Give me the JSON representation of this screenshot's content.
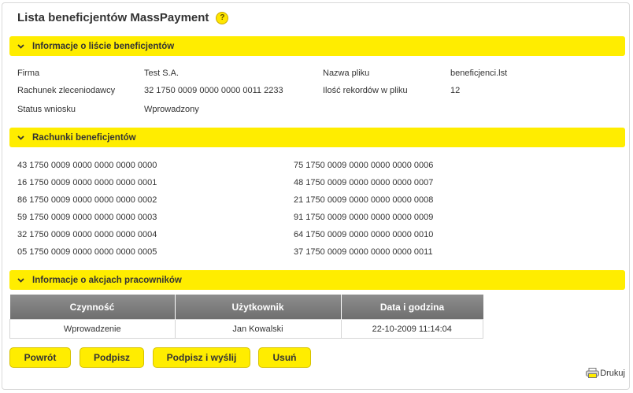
{
  "page": {
    "title": "Lista beneficjentów MassPayment",
    "help_icon": "?"
  },
  "sections": {
    "info": {
      "label": "Informacje o liście beneficjentów"
    },
    "accounts": {
      "label": "Rachunki beneficjentów"
    },
    "actions": {
      "label": "Informacje o akcjach pracowników"
    }
  },
  "info": {
    "firma_label": "Firma",
    "firma_value": "Test S.A.",
    "rachunek_label": "Rachunek zleceniodawcy",
    "rachunek_value": "32 1750 0009 0000 0000 0011 2233",
    "status_label": "Status wniosku",
    "status_value": "Wprowadzony",
    "plik_label": "Nazwa pliku",
    "plik_value": "beneficjenci.lst",
    "rekordy_label": "Ilość rekordów w pliku",
    "rekordy_value": "12"
  },
  "accounts_left": [
    "43 1750 0009 0000 0000 0000 0000",
    "16 1750 0009 0000 0000 0000 0001",
    "86 1750 0009 0000 0000 0000 0002",
    "59 1750 0009 0000 0000 0000 0003",
    "32 1750 0009 0000 0000 0000 0004",
    "05 1750 0009 0000 0000 0000 0005"
  ],
  "accounts_right": [
    "75 1750 0009 0000 0000 0000 0006",
    "48 1750 0009 0000 0000 0000 0007",
    "21 1750 0009 0000 0000 0000 0008",
    "91 1750 0009 0000 0000 0000 0009",
    "64 1750 0009 0000 0000 0000 0010",
    "37 1750 0009 0000 0000 0000 0011"
  ],
  "actions_table": {
    "headers": [
      "Czynność",
      "Użytkownik",
      "Data i godzina"
    ],
    "rows": [
      [
        "Wprowadzenie",
        "Jan Kowalski",
        "22-10-2009 11:14:04"
      ]
    ]
  },
  "buttons": {
    "back": "Powrót",
    "sign": "Podpisz",
    "sign_send": "Podpisz i wyślij",
    "delete": "Usuń"
  },
  "print": {
    "label": "Drukuj"
  },
  "colors": {
    "accent": "#ffed00",
    "header_gray": "#7a7a7a"
  }
}
